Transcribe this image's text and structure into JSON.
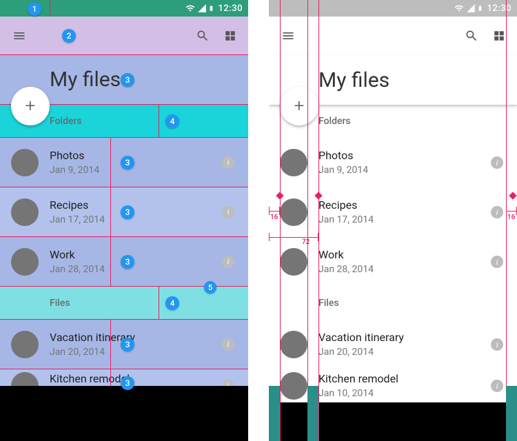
{
  "status": {
    "time": "12:30"
  },
  "header": {
    "title": "My files"
  },
  "sections": {
    "folders_label": "Folders",
    "files_label": "Files"
  },
  "folders": [
    {
      "title": "Photos",
      "subtitle": "Jan 9, 2014"
    },
    {
      "title": "Recipes",
      "subtitle": "Jan 17, 2014"
    },
    {
      "title": "Work",
      "subtitle": "Jan 28, 2014"
    }
  ],
  "files": [
    {
      "title": "Vacation itinerary",
      "subtitle": "Jan 20, 2014"
    },
    {
      "title": "Kitchen remodel",
      "subtitle": "Jan 10, 2014"
    }
  ],
  "fab": {
    "glyph": "+"
  },
  "info_glyph": "i",
  "annotations": {
    "left_badges": {
      "b1": "1",
      "b2": "2",
      "b3": "3",
      "b4": "4",
      "b5": "5"
    },
    "right_dims": {
      "margin": "16",
      "content": "72"
    }
  }
}
